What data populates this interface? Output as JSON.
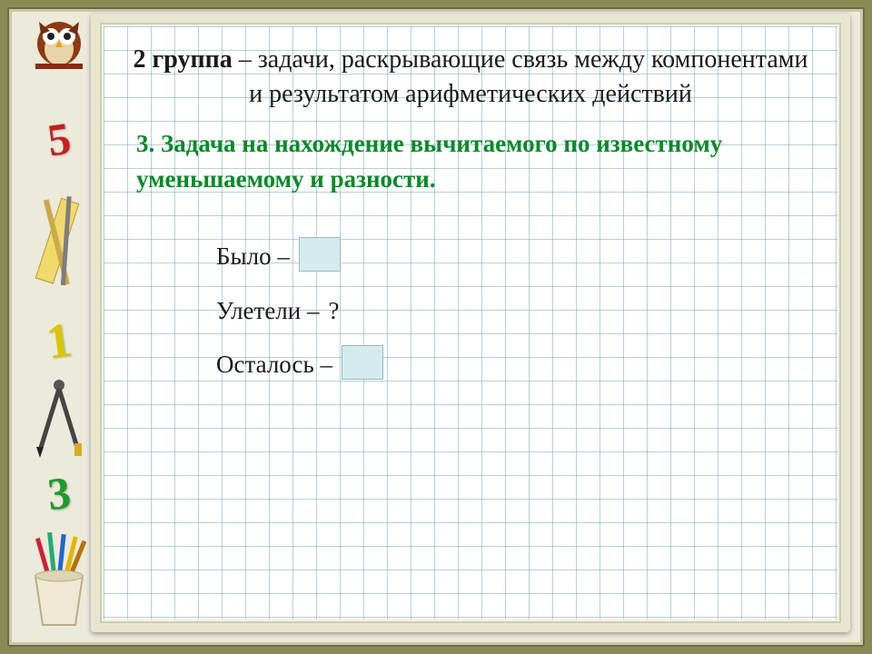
{
  "heading": {
    "bold": "2 группа",
    "rest": " – задачи, раскрывающие связь между компонентами и результатом арифметических действий"
  },
  "subheading": "3. Задача на нахождение вычитаемого по известному уменьшаемому и разности.",
  "rows": {
    "r1_label": "Было –",
    "r2_label": "Улетели –",
    "r2_value": " ?",
    "r3_label": "Осталось –"
  },
  "sidebar": {
    "num5": "5",
    "num1": "1",
    "num3": "3"
  }
}
